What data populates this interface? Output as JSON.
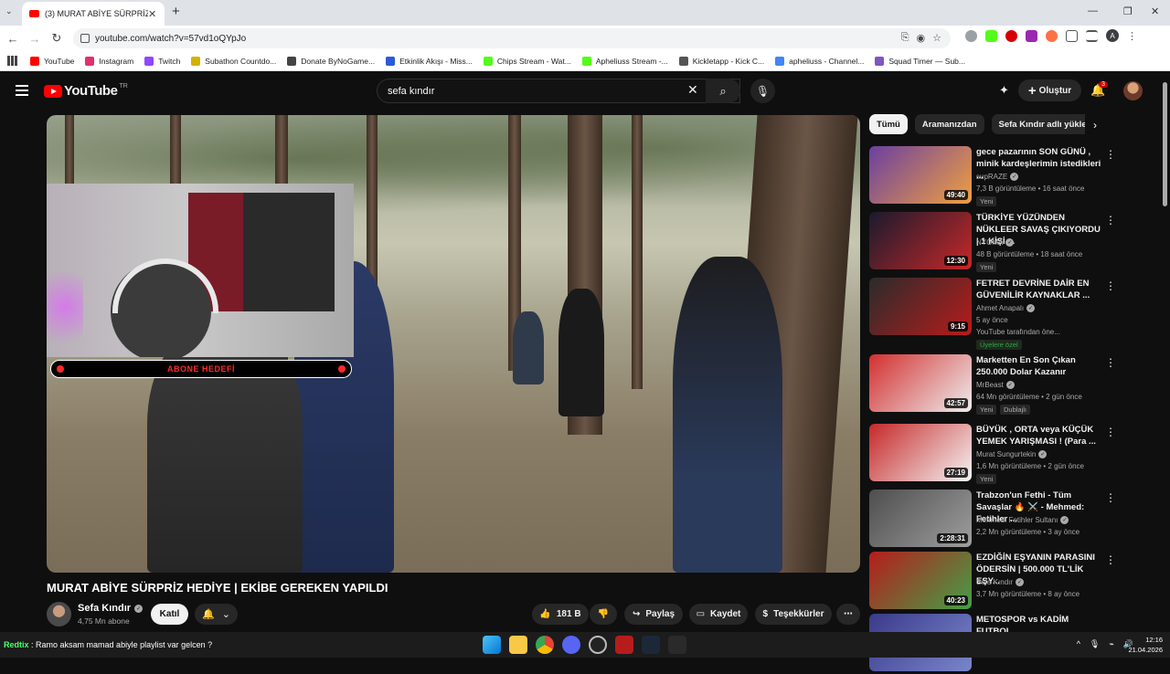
{
  "browser": {
    "tab_title": "(3) MURAT ABİYE SÜRPRİZ HEDİ",
    "url": "youtube.com/watch?v=57vd1oQYpJo",
    "bookmarks": [
      {
        "label": "YouTube",
        "color": "#ff0000"
      },
      {
        "label": "Instagram",
        "color": "#e1306c"
      },
      {
        "label": "Twitch",
        "color": "#9146ff"
      },
      {
        "label": "Subathon Countdo...",
        "color": "#d4b100"
      },
      {
        "label": "Donate ByNoGame...",
        "color": "#444444"
      },
      {
        "label": "Etkinlik Akışı - Miss...",
        "color": "#2a5bd7"
      },
      {
        "label": "Chips Stream - Wat...",
        "color": "#53fc18"
      },
      {
        "label": "Apheliuss Stream -...",
        "color": "#53fc18"
      },
      {
        "label": "Kickletapp - Kick C...",
        "color": "#555555"
      },
      {
        "label": "apheliuss - Channel...",
        "color": "#4285f4"
      },
      {
        "label": "Squad Timer — Sub...",
        "color": "#7e57c2"
      }
    ]
  },
  "youtube": {
    "logo_text": "YouTube",
    "country": "TR",
    "search_value": "sefa kındır",
    "create_label": "Oluştur",
    "notif_count": "3"
  },
  "video": {
    "title": "MURAT ABİYE SÜRPRİZ HEDİYE | EKİBE GEREKEN YAPILDI",
    "channel": "Sefa Kındır",
    "subs": "4,75 Mn abone",
    "join_label": "Katıl",
    "likes": "181 B",
    "share_label": "Paylaş",
    "save_label": "Kaydet",
    "thanks_label": "Teşekkürler",
    "overlay_text": "ABONE HEDEFİ"
  },
  "chips": [
    "Tümü",
    "Aramanızdan",
    "Sefa Kındır adlı yükleyici"
  ],
  "recommendations": [
    {
      "title": "gece pazarının SON GÜNÜ , minik kardeşlerimin istedikleri ...",
      "channel": "supRAZE",
      "meta": "7,3 B görüntüleme • 16 saat önce",
      "badge": "Yeni",
      "duration": "49:40",
      "c1": "#6b3fa0",
      "c2": "#f0a040"
    },
    {
      "title": "TÜRKİYE YÜZÜNDEN NÜKLEER SAVAŞ ÇIKIYORDU | 1 KİŞİ ...",
      "channel": "NYGMA",
      "meta": "48 B görüntüleme • 18 saat önce",
      "badge": "Yeni",
      "duration": "12:30",
      "c1": "#1a1a2e",
      "c2": "#c62828"
    },
    {
      "title": "FETRET DEVRİNE DAİR EN GÜVENİLİR KAYNAKLAR ...",
      "channel": "Ahmet Anapalı",
      "meta": "5 ay önce",
      "badge": "YouTube tarafından öne...",
      "badge2": "Üyelere özel",
      "duration": "9:15",
      "c1": "#2b2b2b",
      "c2": "#b71c1c"
    },
    {
      "title": "Marketten En Son Çıkan 250.000 Dolar Kazanır",
      "channel": "MrBeast",
      "meta": "64 Mn görüntüleme • 2 gün önce",
      "badge": "Yeni",
      "badge2": "Dublajlı",
      "duration": "42:57",
      "c1": "#d32f2f",
      "c2": "#eeeeee"
    },
    {
      "title": "BÜYÜK , ORTA veya KÜÇÜK YEMEK YARIŞMASI ! (Para ...",
      "channel": "Murat Sungurtekin",
      "meta": "1,6 Mn görüntüleme • 2 gün önce",
      "badge": "Yeni",
      "duration": "27:19",
      "c1": "#c62828",
      "c2": "#f5f5f5"
    },
    {
      "title": "Trabzon'un Fethi - Tüm Savaşlar 🔥 ⚔️ - Mehmed: Fetihler ...",
      "channel": "Mehmed: Fetihler Sultanı",
      "meta": "2,2 Mn görüntüleme • 3 ay önce",
      "duration": "2:28:31",
      "c1": "#4e4e4e",
      "c2": "#9e9e9e"
    },
    {
      "title": "EZDİĞİN EŞYANIN PARASINI ÖDERSİN | 500.000 TL'LİK EŞY...",
      "channel": "Sefa Kındır",
      "meta": "3,7 Mn görüntüleme • 8 ay önce",
      "duration": "40:23",
      "c1": "#b71c1c",
      "c2": "#43a047"
    },
    {
      "title": "METOSPOR vs KADİM FUTBOL",
      "channel": "",
      "meta": "",
      "duration": "",
      "c1": "#3a3a8a",
      "c2": "#7986cb"
    }
  ],
  "taskbar": {
    "chat_user": "Redtix",
    "chat_msg": ": Ramo aksam mamad abiyle playlist var gelcen ?",
    "time": "12:16",
    "date": "21.04.2026"
  }
}
